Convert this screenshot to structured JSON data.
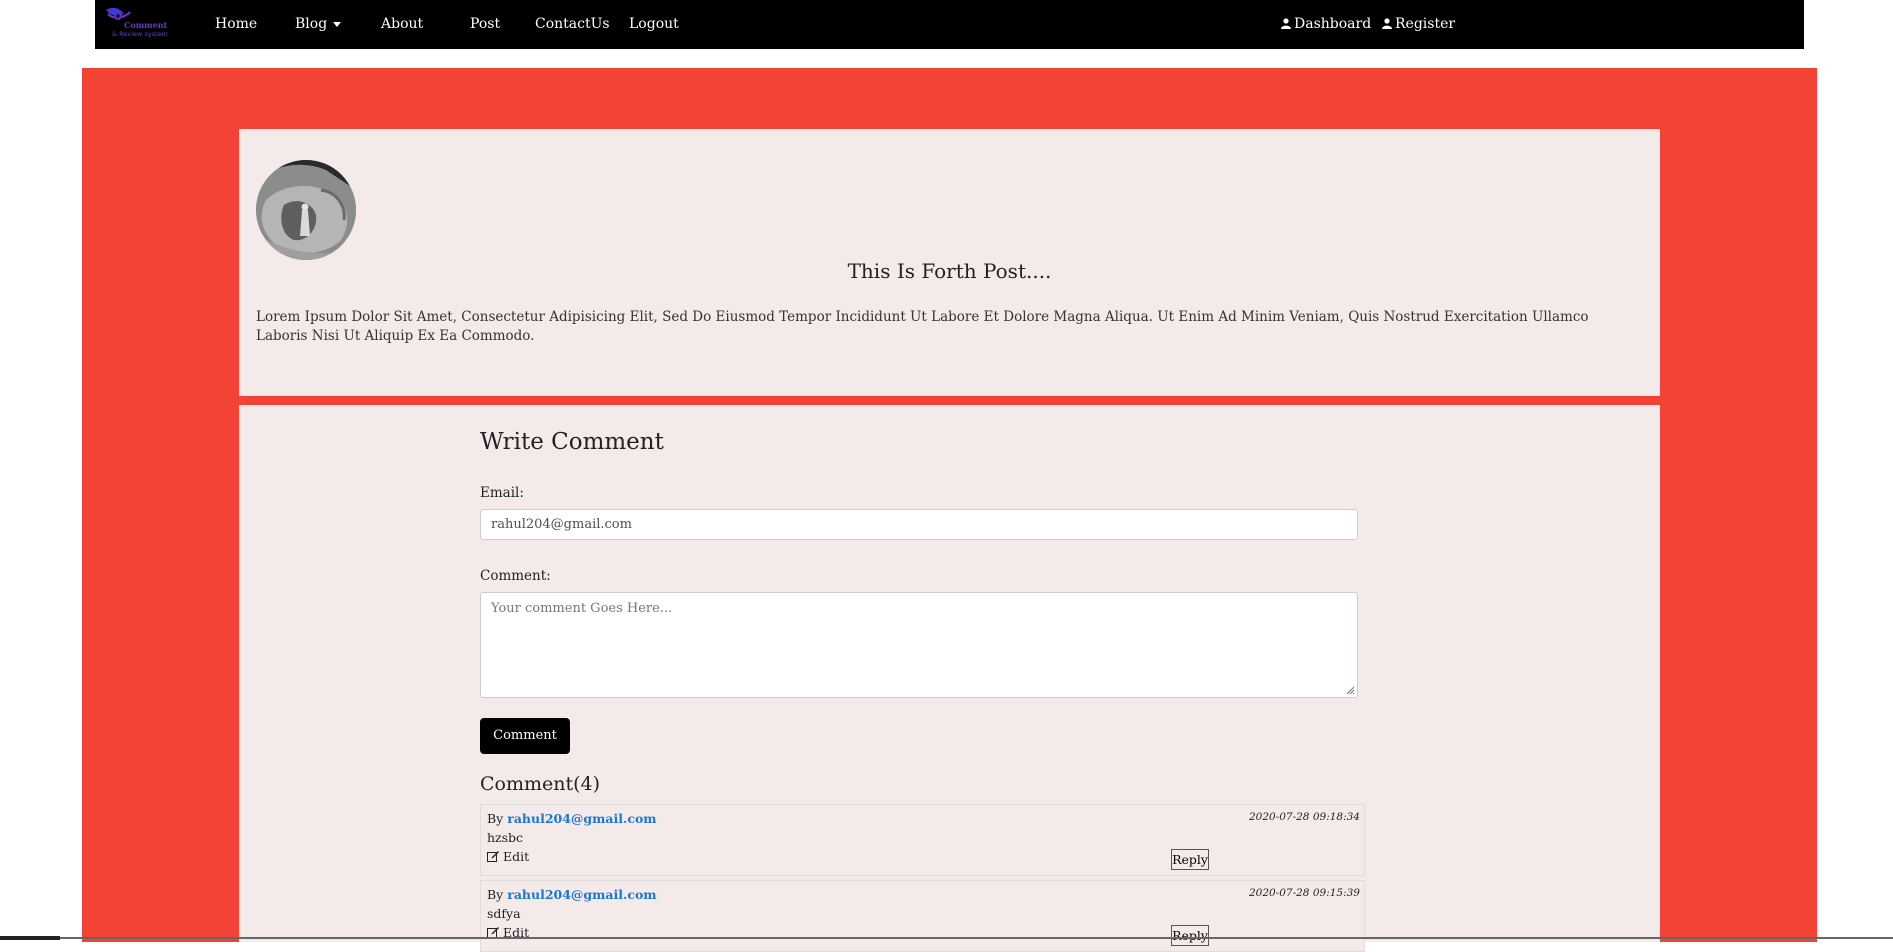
{
  "nav": {
    "logo_text_line1": "Comment",
    "logo_text_line2": "& Review system",
    "items": [
      {
        "label": "Home"
      },
      {
        "label": "Blog"
      },
      {
        "label": "About"
      },
      {
        "label": "Post"
      },
      {
        "label": "ContactUs"
      },
      {
        "label": "Logout"
      }
    ],
    "right": [
      {
        "label": "Dashboard"
      },
      {
        "label": "Register"
      }
    ]
  },
  "post": {
    "title": "This Is Forth Post....",
    "body": "Lorem Ipsum Dolor Sit Amet, Consectetur Adipisicing Elit, Sed Do Eiusmod Tempor Incididunt Ut Labore Et Dolore Magna Aliqua. Ut Enim Ad Minim Veniam, Quis Nostrud Exercitation Ullamco Laboris Nisi Ut Aliquip Ex Ea Commodo."
  },
  "form": {
    "title": "Write Comment",
    "email_label": "Email:",
    "email_value": "rahul204@gmail.com",
    "comment_label": "Comment:",
    "comment_placeholder": "Your comment Goes Here...",
    "submit_label": "Comment"
  },
  "comments": {
    "heading": "Comment(4)",
    "by_label": "By",
    "edit_label": "Edit",
    "reply_label": "Reply",
    "items": [
      {
        "email": "rahul204@gmail.com",
        "text": "hzsbc",
        "date": "2020-07-28 09:18:34"
      },
      {
        "email": "rahul204@gmail.com",
        "text": "sdfya",
        "date": "2020-07-28 09:15:39"
      }
    ]
  },
  "colors": {
    "navbar": "#000000",
    "page_accent": "#f44336",
    "card": "#f4eaea",
    "link": "#1976d2"
  }
}
